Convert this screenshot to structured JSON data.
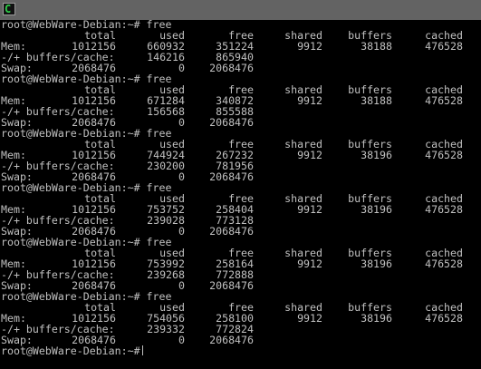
{
  "app": {
    "icon": "terminal-icon",
    "icon_glyph": "C"
  },
  "terminal": {
    "blocks": [
      {
        "prompt": "root@WebWare-Debian:~# free",
        "header": [
          "total",
          "used",
          "free",
          "shared",
          "buffers",
          "cached"
        ],
        "mem": {
          "label": "Mem:",
          "total": "1012156",
          "used": "660932",
          "free": "351224",
          "shared": "9912",
          "buffers": "38188",
          "cached": "476528"
        },
        "bufcache": {
          "label": "-/+ buffers/cache:",
          "used": "146216",
          "free": "865940"
        },
        "swap": {
          "label": "Swap:",
          "total": "2068476",
          "used": "0",
          "free": "2068476"
        }
      },
      {
        "prompt": "root@WebWare-Debian:~# free",
        "header": [
          "total",
          "used",
          "free",
          "shared",
          "buffers",
          "cached"
        ],
        "mem": {
          "label": "Mem:",
          "total": "1012156",
          "used": "671284",
          "free": "340872",
          "shared": "9912",
          "buffers": "38188",
          "cached": "476528"
        },
        "bufcache": {
          "label": "-/+ buffers/cache:",
          "used": "156568",
          "free": "855588"
        },
        "swap": {
          "label": "Swap:",
          "total": "2068476",
          "used": "0",
          "free": "2068476"
        }
      },
      {
        "prompt": "root@WebWare-Debian:~# free",
        "header": [
          "total",
          "used",
          "free",
          "shared",
          "buffers",
          "cached"
        ],
        "mem": {
          "label": "Mem:",
          "total": "1012156",
          "used": "744924",
          "free": "267232",
          "shared": "9912",
          "buffers": "38196",
          "cached": "476528"
        },
        "bufcache": {
          "label": "-/+ buffers/cache:",
          "used": "230200",
          "free": "781956"
        },
        "swap": {
          "label": "Swap:",
          "total": "2068476",
          "used": "0",
          "free": "2068476"
        }
      },
      {
        "prompt": "root@WebWare-Debian:~# free",
        "header": [
          "total",
          "used",
          "free",
          "shared",
          "buffers",
          "cached"
        ],
        "mem": {
          "label": "Mem:",
          "total": "1012156",
          "used": "753752",
          "free": "258404",
          "shared": "9912",
          "buffers": "38196",
          "cached": "476528"
        },
        "bufcache": {
          "label": "-/+ buffers/cache:",
          "used": "239028",
          "free": "773128"
        },
        "swap": {
          "label": "Swap:",
          "total": "2068476",
          "used": "0",
          "free": "2068476"
        }
      },
      {
        "prompt": "root@WebWare-Debian:~# free",
        "header": [
          "total",
          "used",
          "free",
          "shared",
          "buffers",
          "cached"
        ],
        "mem": {
          "label": "Mem:",
          "total": "1012156",
          "used": "753992",
          "free": "258164",
          "shared": "9912",
          "buffers": "38196",
          "cached": "476528"
        },
        "bufcache": {
          "label": "-/+ buffers/cache:",
          "used": "239268",
          "free": "772888"
        },
        "swap": {
          "label": "Swap:",
          "total": "2068476",
          "used": "0",
          "free": "2068476"
        }
      },
      {
        "prompt": "root@WebWare-Debian:~# free",
        "header": [
          "total",
          "used",
          "free",
          "shared",
          "buffers",
          "cached"
        ],
        "mem": {
          "label": "Mem:",
          "total": "1012156",
          "used": "754056",
          "free": "258100",
          "shared": "9912",
          "buffers": "38196",
          "cached": "476528"
        },
        "bufcache": {
          "label": "-/+ buffers/cache:",
          "used": "239332",
          "free": "772824"
        },
        "swap": {
          "label": "Swap:",
          "total": "2068476",
          "used": "0",
          "free": "2068476"
        }
      }
    ],
    "final_prompt": "root@WebWare-Debian:~#"
  }
}
